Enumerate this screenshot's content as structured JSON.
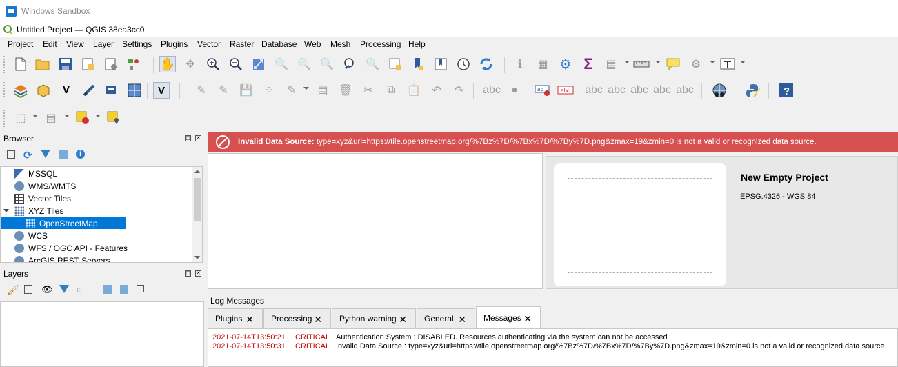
{
  "sandbox": {
    "title": "Windows Sandbox"
  },
  "window": {
    "title": "Untitled Project — QGIS 38ea3cc0"
  },
  "menu": [
    "Project",
    "Edit",
    "View",
    "Layer",
    "Settings",
    "Plugins",
    "Vector",
    "Raster",
    "Database",
    "Web",
    "Mesh",
    "Processing",
    "Help"
  ],
  "browser": {
    "title": "Browser",
    "items": [
      {
        "label": "MSSQL",
        "icon": "mssql-icon"
      },
      {
        "label": "WMS/WMTS",
        "icon": "globe-icon"
      },
      {
        "label": "Vector Tiles",
        "icon": "grid-icon"
      },
      {
        "label": "XYZ Tiles",
        "icon": "grid-icon"
      },
      {
        "label": "OpenStreetMap",
        "icon": "tiles-icon"
      },
      {
        "label": "WCS",
        "icon": "globe-icon"
      },
      {
        "label": "WFS / OGC API - Features",
        "icon": "globe-icon"
      },
      {
        "label": "ArcGIS REST Servers",
        "icon": "globe-icon"
      }
    ]
  },
  "layers": {
    "title": "Layers"
  },
  "error_bar": {
    "label": "Invalid Data Source:",
    "message": "type=xyz&url=https://tile.openstreetmap.org/%7Bz%7D/%7Bx%7D/%7By%7D.png&zmax=19&zmin=0 is not a valid or recognized data source."
  },
  "welcome": {
    "title": "New Empty Project",
    "crs": "EPSG:4326 - WGS 84"
  },
  "log": {
    "title": "Log Messages",
    "tabs": [
      "Plugins",
      "Processing",
      "Python warning",
      "General",
      "Messages"
    ],
    "active_tab": "Messages",
    "entries": [
      {
        "time": "2021-07-14T13:50:21",
        "level": "CRITICAL",
        "text": "Authentication System : DISABLED. Resources authenticating via the system can not be accessed"
      },
      {
        "time": "2021-07-14T13:50:31",
        "level": "CRITICAL",
        "text": "Invalid Data Source : type=xyz&url=https://tile.openstreetmap.org/%7Bz%7D/%7Bx%7D/%7By%7D.png&zmax=19&zmin=0 is not a valid or recognized data source."
      }
    ]
  },
  "colors": {
    "error": "#d65050",
    "selection": "#0078d7",
    "critical": "#c00000"
  }
}
